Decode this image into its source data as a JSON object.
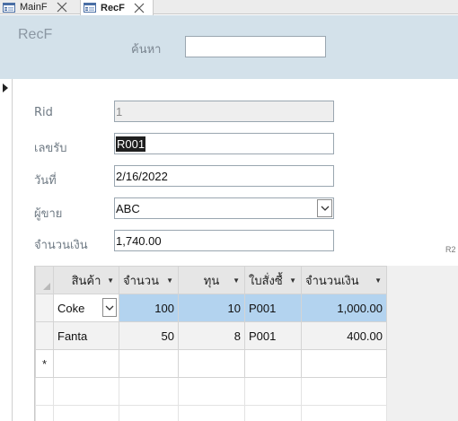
{
  "tabs": [
    {
      "label": "MainF",
      "icon": "form-icon",
      "close_icon": "close-icon",
      "active": false
    },
    {
      "label": "RecF",
      "icon": "form-icon",
      "close_icon": "close-icon",
      "active": true
    }
  ],
  "header": {
    "title": "RecF",
    "search_label": "ค้นหา",
    "search_value": ""
  },
  "fields": {
    "rid": {
      "label": "Rid",
      "value": "1"
    },
    "receipt_no": {
      "label": "เลขรับ",
      "value": "R001"
    },
    "date": {
      "label": "วันที่",
      "value": "2/16/2022"
    },
    "vendor": {
      "label": "ผู้ขาย",
      "value": "ABC"
    },
    "amount": {
      "label": "จำนวนเงิน",
      "value": "1,740.00"
    }
  },
  "side_text": "R2",
  "subform": {
    "columns": [
      "สินค้า",
      "จำนวน",
      "ทุน",
      "ใบสั่งซื้",
      "จำนวนเงิน"
    ],
    "rows": [
      {
        "product": "Coke",
        "qty": "100",
        "cost": "10",
        "po": "P001",
        "amount": "1,000.00"
      },
      {
        "product": "Fanta",
        "qty": "50",
        "cost": "8",
        "po": "P001",
        "amount": "400.00"
      }
    ],
    "new_row_marker": "*"
  },
  "colors": {
    "header_bg": "#d3e1ea",
    "selected_cell": "#b3d3ef",
    "label_text": "#6f7a84"
  }
}
